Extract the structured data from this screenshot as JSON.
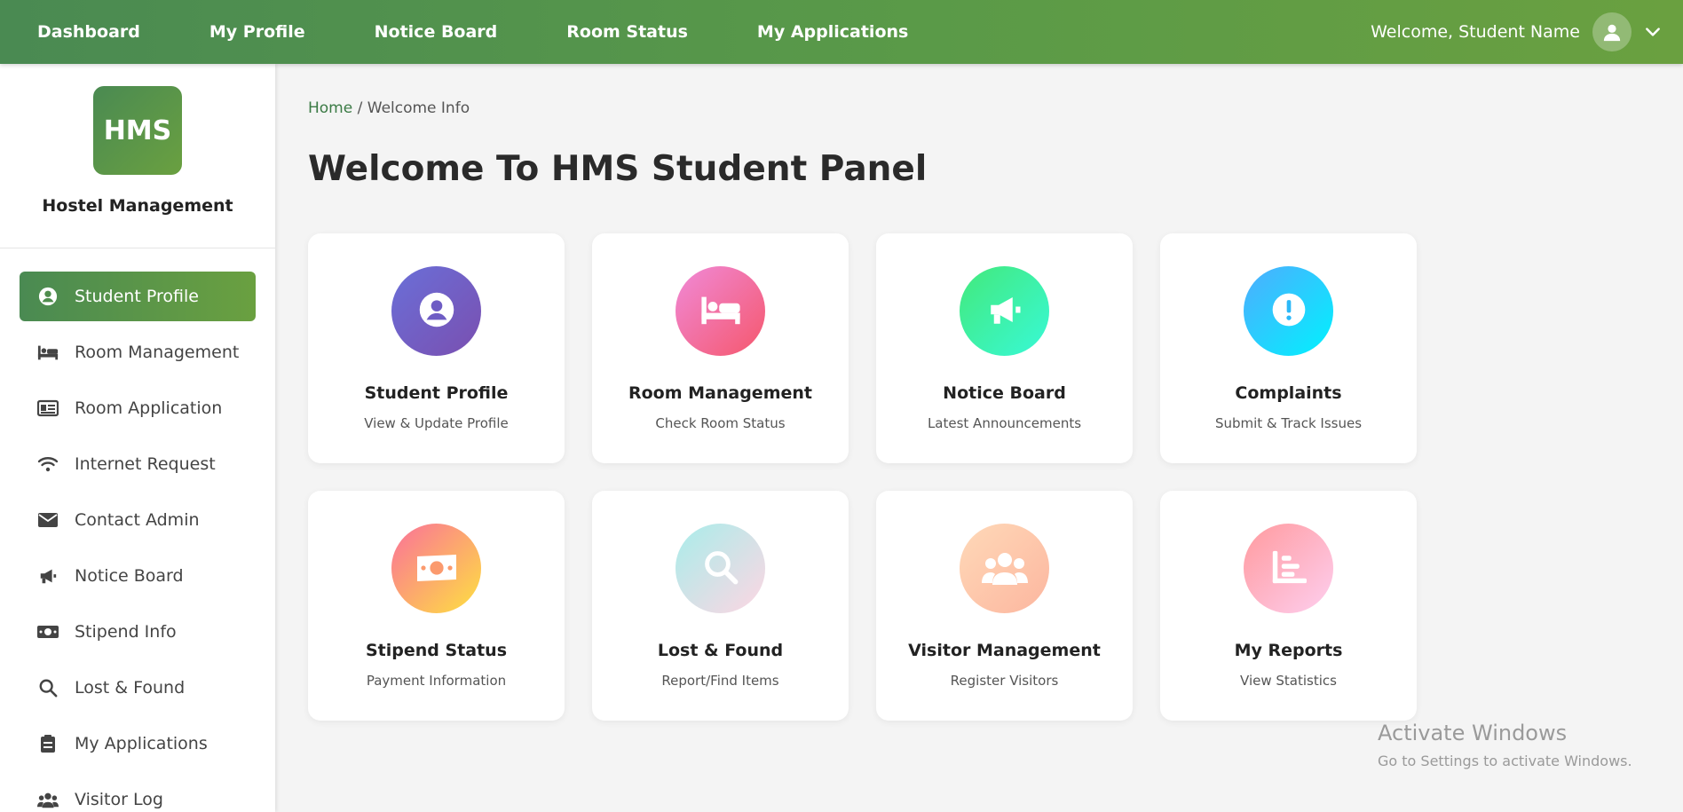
{
  "topnav": {
    "links": [
      "Dashboard",
      "My Profile",
      "Notice Board",
      "Room Status",
      "My Applications"
    ],
    "welcome": "Welcome, Student Name",
    "icons": {
      "avatar": "user-icon",
      "dropdown": "chevron-down-icon"
    }
  },
  "sidebar": {
    "logo": "HMS",
    "brand_name": "Hostel Management",
    "items": [
      {
        "label": "Student Profile",
        "icon": "user-circle-icon",
        "active": true
      },
      {
        "label": "Room Management",
        "icon": "bed-icon"
      },
      {
        "label": "Room Application",
        "icon": "id-card-icon"
      },
      {
        "label": "Internet Request",
        "icon": "wifi-icon"
      },
      {
        "label": "Contact Admin",
        "icon": "envelope-icon"
      },
      {
        "label": "Notice Board",
        "icon": "megaphone-icon"
      },
      {
        "label": "Stipend Info",
        "icon": "money-icon"
      },
      {
        "label": "Lost & Found",
        "icon": "search-icon"
      },
      {
        "label": "My Applications",
        "icon": "clipboard-icon"
      },
      {
        "label": "Visitor Log",
        "icon": "users-icon"
      }
    ],
    "accent": "#4a8a52"
  },
  "main": {
    "breadcrumb": {
      "home": "Home",
      "separator": " / ",
      "current": "Welcome Info"
    },
    "title": "Welcome To HMS Student Panel",
    "cards": [
      {
        "title": "Student Profile",
        "subtitle": "View & Update Profile",
        "icon": "user-circle-icon",
        "gradient": [
          "#6a6fd8",
          "#7a4fb0"
        ]
      },
      {
        "title": "Room Management",
        "subtitle": "Check Room Status",
        "icon": "bed-icon",
        "gradient": [
          "#f08ad8",
          "#f5576c"
        ]
      },
      {
        "title": "Notice Board",
        "subtitle": "Latest Announcements",
        "icon": "megaphone-icon",
        "gradient": [
          "#43e97b",
          "#38f9d7"
        ]
      },
      {
        "title": "Complaints",
        "subtitle": "Submit & Track Issues",
        "icon": "exclamation-circle-icon",
        "gradient": [
          "#4facfe",
          "#00f2fe"
        ]
      },
      {
        "title": "Stipend Status",
        "subtitle": "Payment Information",
        "icon": "money-icon",
        "gradient": [
          "#fa709a",
          "#fee140"
        ]
      },
      {
        "title": "Lost & Found",
        "subtitle": "Report/Find Items",
        "icon": "search-icon",
        "gradient": [
          "#a8edea",
          "#fed6e3"
        ]
      },
      {
        "title": "Visitor Management",
        "subtitle": "Register Visitors",
        "icon": "users-icon",
        "gradient": [
          "#ffd9b8",
          "#fcb69f"
        ]
      },
      {
        "title": "My Reports",
        "subtitle": "View Statistics",
        "icon": "chart-icon",
        "gradient": [
          "#ff9a9e",
          "#fecfef"
        ]
      }
    ]
  },
  "watermark": {
    "line1": "Activate Windows",
    "line2": "Go to Settings to activate Windows."
  }
}
